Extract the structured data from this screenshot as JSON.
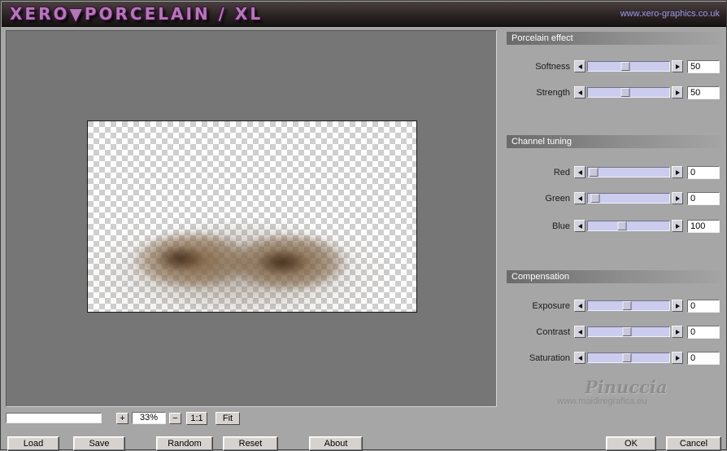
{
  "header": {
    "title": "XERO▼PORCELAIN / XL",
    "website": "www.xero-graphics.co.uk"
  },
  "groups": [
    {
      "title": "Porcelain effect",
      "sliders": [
        {
          "label": "Softness",
          "value": "50",
          "thumb": 46
        },
        {
          "label": "Strength",
          "value": "50",
          "thumb": 46
        }
      ]
    },
    {
      "title": "Channel tuning",
      "sliders": [
        {
          "label": "Red",
          "value": "0",
          "thumb": 7
        },
        {
          "label": "Green",
          "value": "0",
          "thumb": 9
        },
        {
          "label": "Blue",
          "value": "100",
          "thumb": 42
        }
      ]
    },
    {
      "title": "Compensation",
      "sliders": [
        {
          "label": "Exposure",
          "value": "0",
          "thumb": 48
        },
        {
          "label": "Contrast",
          "value": "0",
          "thumb": 48
        },
        {
          "label": "Saturation",
          "value": "0",
          "thumb": 48
        }
      ]
    }
  ],
  "zoom": {
    "plus": "+",
    "value": "33%",
    "minus": "−",
    "actual": "1:1",
    "fit": "Fit"
  },
  "watermark": {
    "name": "Pinuccia",
    "site": "www.maidiregrafica.eu"
  },
  "buttons": {
    "load": "Load",
    "save": "Save",
    "random": "Random",
    "reset": "Reset",
    "about": "About",
    "ok": "OK",
    "cancel": "Cancel"
  },
  "colors": {
    "track": "#ccccee",
    "title_text": "#b478b4",
    "link_text": "#9a9ae8",
    "dialog_bg": "#a6a6a6",
    "preview_bg": "#767676"
  }
}
